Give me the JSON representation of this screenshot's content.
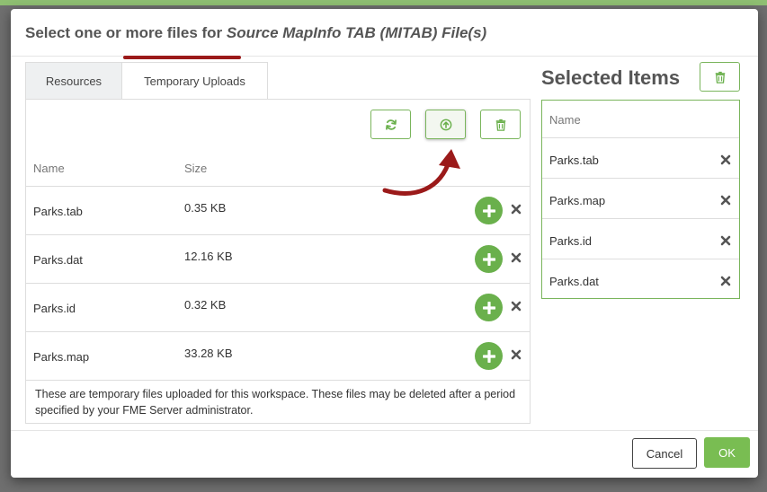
{
  "dialog": {
    "title_prefix": "Select one or more files for ",
    "title_emphasis": "Source MapInfo TAB (MITAB) File(s)"
  },
  "tabs": [
    {
      "label": "Resources",
      "active": false
    },
    {
      "label": "Temporary Uploads",
      "active": true
    }
  ],
  "toolbar": {
    "icons": [
      "refresh-icon",
      "upload-icon",
      "trash-icon"
    ]
  },
  "file_table": {
    "columns": [
      "Name",
      "Size"
    ],
    "rows": [
      {
        "name": "Parks.tab",
        "size": "0.35 KB"
      },
      {
        "name": "Parks.dat",
        "size": "12.16 KB"
      },
      {
        "name": "Parks.id",
        "size": "0.32 KB"
      },
      {
        "name": "Parks.map",
        "size": "33.28 KB"
      }
    ],
    "note": "These are temporary files uploaded for this workspace. These files may be deleted after a period specified by your FME Server administrator."
  },
  "selected": {
    "title": "Selected Items",
    "column": "Name",
    "items": [
      "Parks.tab",
      "Parks.map",
      "Parks.id",
      "Parks.dat"
    ]
  },
  "footer": {
    "cancel_label": "Cancel",
    "ok_label": "OK"
  },
  "colors": {
    "accent_green": "#6ab04c",
    "annotation_red": "#9b1a1a"
  }
}
